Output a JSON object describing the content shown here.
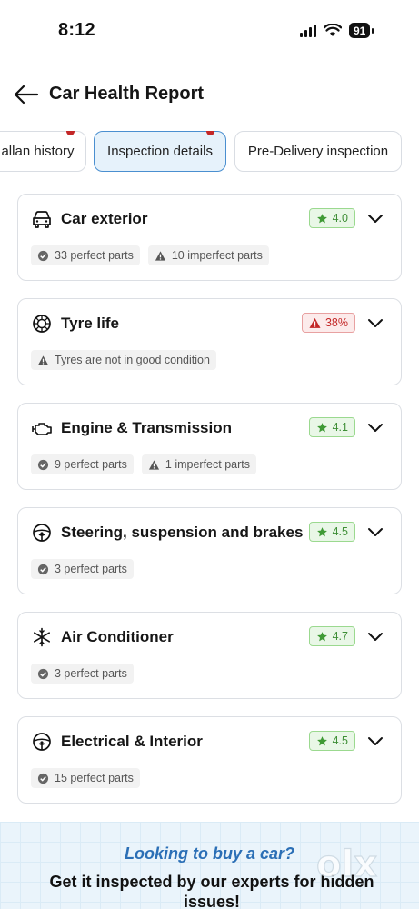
{
  "status_bar": {
    "time": "8:12",
    "battery": "91"
  },
  "header": {
    "title": "Car Health Report"
  },
  "tabs": [
    {
      "label": "allan history",
      "active": false,
      "badge": true
    },
    {
      "label": "Inspection details",
      "active": true,
      "badge": true
    },
    {
      "label": "Pre-Delivery inspection",
      "active": false,
      "badge": false
    }
  ],
  "cards": [
    {
      "icon": "car-icon",
      "title": "Car exterior",
      "rating": "4.0",
      "rating_type": "good",
      "chips": [
        {
          "icon": "check-circle-icon",
          "text": "33 perfect parts"
        },
        {
          "icon": "warning-icon",
          "text": "10 imperfect parts"
        }
      ]
    },
    {
      "icon": "tyre-icon",
      "title": "Tyre life",
      "rating": "38%",
      "rating_type": "bad",
      "chips": [
        {
          "icon": "warning-icon",
          "text": "Tyres are not in good condition"
        }
      ]
    },
    {
      "icon": "engine-icon",
      "title": "Engine & Transmission",
      "rating": "4.1",
      "rating_type": "good",
      "chips": [
        {
          "icon": "check-circle-icon",
          "text": "9 perfect parts"
        },
        {
          "icon": "warning-icon",
          "text": "1 imperfect parts"
        }
      ]
    },
    {
      "icon": "steering-icon",
      "title": "Steering, suspension and brakes",
      "rating": "4.5",
      "rating_type": "good",
      "chips": [
        {
          "icon": "check-circle-icon",
          "text": "3 perfect parts"
        }
      ]
    },
    {
      "icon": "snowflake-icon",
      "title": "Air Conditioner",
      "rating": "4.7",
      "rating_type": "good",
      "chips": [
        {
          "icon": "check-circle-icon",
          "text": "3 perfect parts"
        }
      ]
    },
    {
      "icon": "steering-icon",
      "title": "Electrical & Interior",
      "rating": "4.5",
      "rating_type": "good",
      "chips": [
        {
          "icon": "check-circle-icon",
          "text": "15 perfect parts"
        }
      ]
    }
  ],
  "banner": {
    "question": "Looking to buy a car?",
    "text": "Get it inspected by our experts for  hidden issues!",
    "watermark": "olx"
  },
  "colors": {
    "accent_blue": "#2b6fb6",
    "good_green": "#3f8f37",
    "bad_red": "#c32727",
    "tab_active_bg": "#e6f2fb"
  }
}
